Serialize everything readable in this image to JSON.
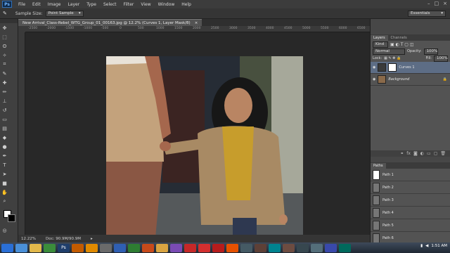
{
  "app": {
    "logo": "Ps",
    "menu": [
      "File",
      "Edit",
      "Image",
      "Layer",
      "Type",
      "Select",
      "Filter",
      "View",
      "Window",
      "Help"
    ],
    "window_controls": [
      "–",
      "□",
      "×"
    ]
  },
  "options_bar": {
    "sample_size_label": "Sample Size:",
    "sample_size_value": "Point Sample",
    "workspace": "Essentials"
  },
  "document": {
    "tab_title": "New Arrival_Class-Rebel_WTG_Group_01_00163.jpg @ 12.2% (Curves 1, Layer Mask/8)",
    "ruler_ticks": [
      "-2500",
      "-2000",
      "-1500",
      "-1000",
      "-500",
      "0",
      "500",
      "1000",
      "1500",
      "2000",
      "2500",
      "3000",
      "3500",
      "4000",
      "4500",
      "5000",
      "5500",
      "6000",
      "6500"
    ]
  },
  "status": {
    "zoom": "12.22%",
    "doc_size": "Doc: 90.9M/90.9M"
  },
  "layers_panel": {
    "tabs": [
      "Layers",
      "Channels"
    ],
    "kind_label": "Kind",
    "blend_mode": "Normal",
    "opacity_label": "Opacity:",
    "opacity_value": "100%",
    "lock_label": "Lock:",
    "fill_label": "Fill:",
    "fill_value": "100%",
    "layers": [
      {
        "name": "Curves 1",
        "selected": true
      },
      {
        "name": "Background",
        "selected": false
      }
    ]
  },
  "paths_panel": {
    "tab": "Paths",
    "paths": [
      "Path 1",
      "Path 2",
      "Path 3",
      "Path 4",
      "Path 5",
      "Path 6"
    ]
  },
  "taskbar": {
    "clock": "1:51 AM",
    "apps": [
      "win",
      "ie",
      "folder",
      "chrome",
      "Ps",
      "ai",
      "vlc",
      "app",
      "word",
      "excel",
      "ppt",
      "folder2",
      "media",
      "red",
      "red2",
      "opera",
      "ff",
      "app3",
      "app4",
      "app5",
      "app6",
      "app7",
      "app8",
      "app9",
      "app10"
    ],
    "app_colors": [
      "#2a6fd6",
      "#4a90d9",
      "#e1b84b",
      "#3b8d3b",
      "#1f3e6b",
      "#c35b00",
      "#e08a00",
      "#6a6a6a",
      "#2f5fb3",
      "#2e7d32",
      "#c84a1a",
      "#d9a441",
      "#7a4bb3",
      "#c62828",
      "#d32f2f",
      "#b71c1c",
      "#e65100",
      "#455a64",
      "#5d4037",
      "#00838f",
      "#6d4c41",
      "#37474f",
      "#546e7a",
      "#3949ab",
      "#00695c"
    ]
  }
}
